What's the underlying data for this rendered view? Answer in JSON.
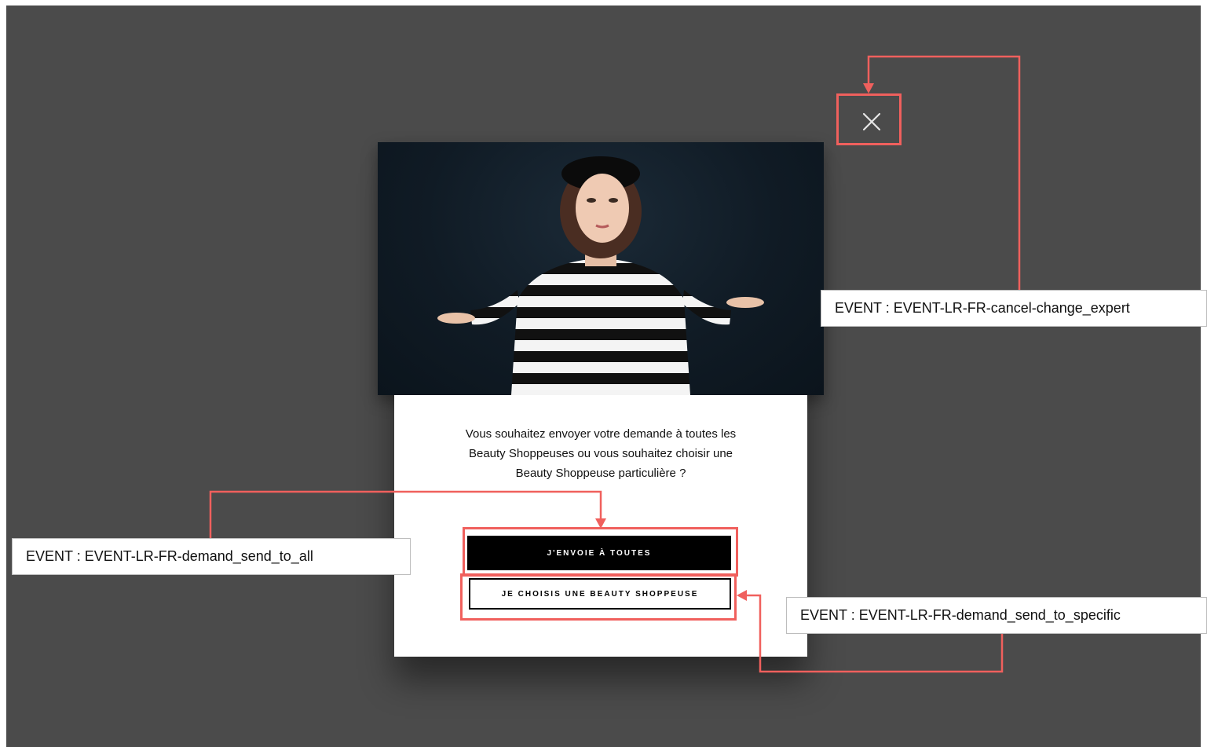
{
  "modal": {
    "question": "Vous souhaitez envoyer votre demande à toutes les Beauty Shoppeuses ou vous souhaitez choisir une Beauty Shoppeuse particulière ?",
    "send_to_all_label": "J'ENVOIE À TOUTES",
    "choose_specific_label": "JE CHOISIS UNE BEAUTY SHOPPEUSE"
  },
  "annotations": {
    "cancel_event": "EVENT : EVENT-LR-FR-cancel-change_expert",
    "send_to_all_event": "EVENT : EVENT-LR-FR-demand_send_to_all",
    "send_to_specific_event": "EVENT : EVENT-LR-FR-demand_send_to_specific"
  },
  "colors": {
    "overlay": "#4b4b4b",
    "annotation_red": "#f0605d",
    "primary_button": "#000000"
  },
  "icons": {
    "close": "close-icon"
  }
}
